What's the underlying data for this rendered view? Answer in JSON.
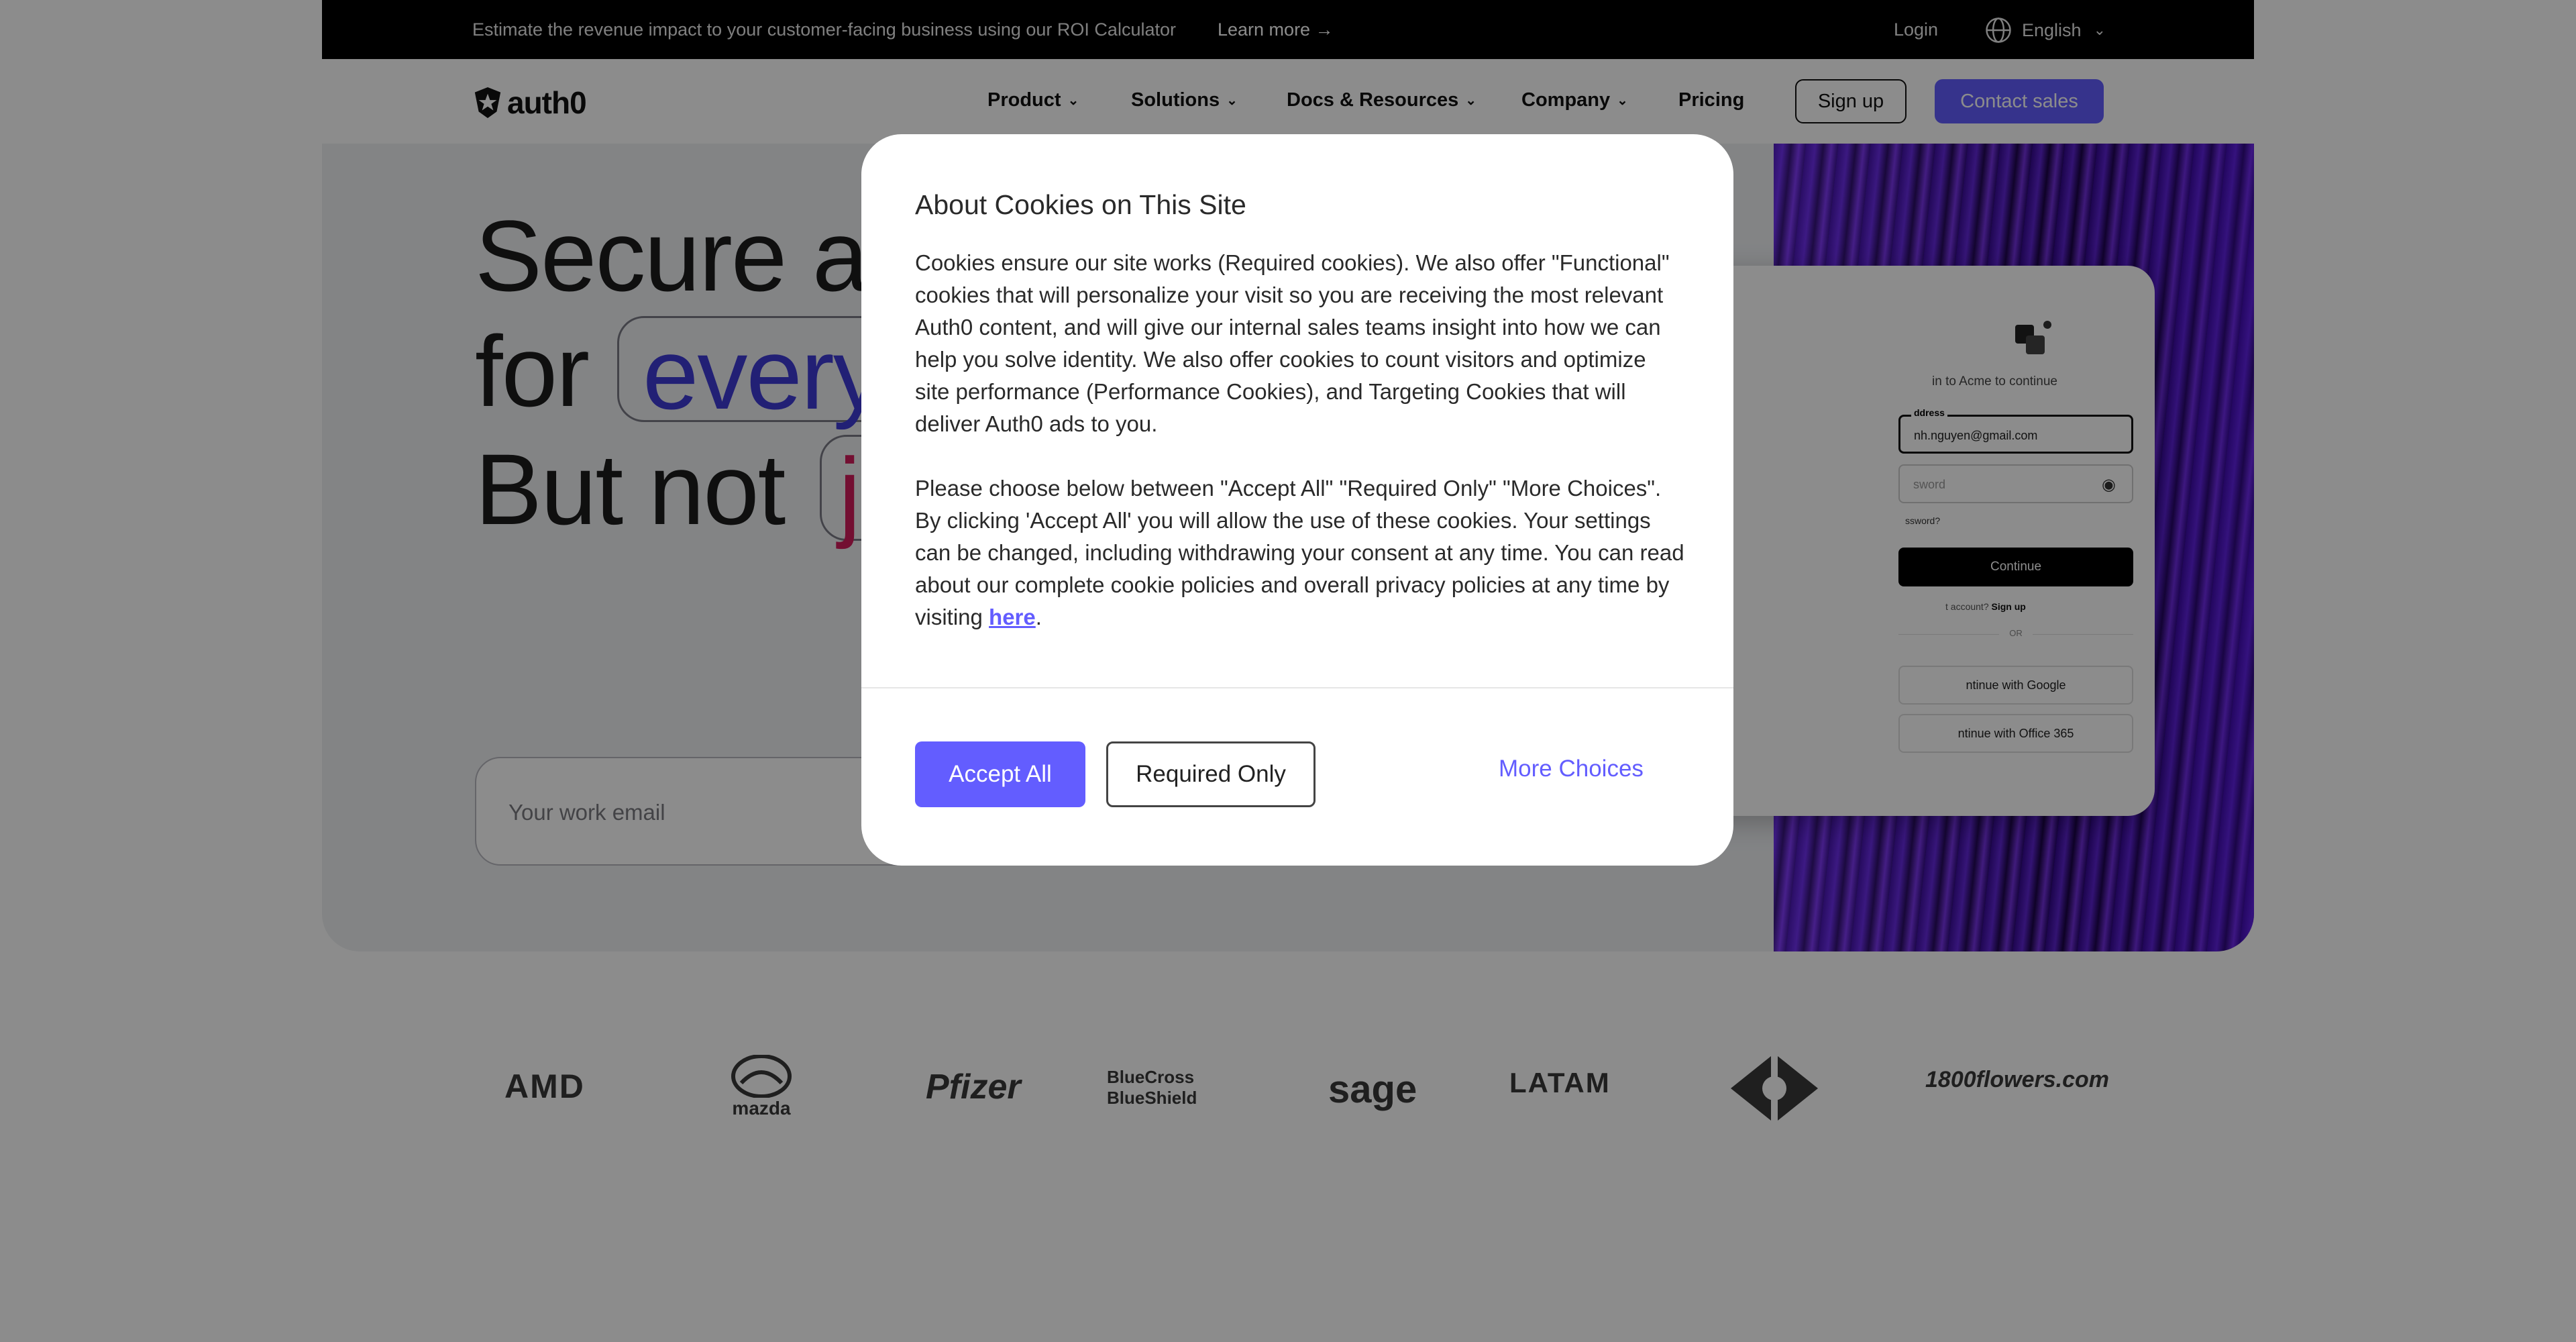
{
  "announcement": {
    "message": "Estimate the revenue impact to your customer-facing business using our ROI Calculator",
    "learn_more": "Learn more →",
    "login": "Login",
    "language": "English"
  },
  "nav": {
    "logo": "auth0",
    "items": [
      {
        "label": "Product",
        "has_dropdown": true
      },
      {
        "label": "Solutions",
        "has_dropdown": true
      },
      {
        "label": "Docs & Resources",
        "has_dropdown": true
      },
      {
        "label": "Company",
        "has_dropdown": true
      },
      {
        "label": "Pricing",
        "has_dropdown": false
      }
    ],
    "signup": "Sign up",
    "contact_sales": "Contact sales"
  },
  "hero": {
    "line1": "Secure a",
    "line2_prefix": "for",
    "line2_highlight": "every",
    "line3_prefix": "But not",
    "line3_highlight": "j",
    "email_placeholder": "Your work email"
  },
  "login_card": {
    "subtitle": "in to Acme to continue",
    "email_label": "ddress",
    "email_value": "nh.nguyen@gmail.com",
    "password_placeholder": "sword",
    "forgot": "ssword?",
    "continue": "Continue",
    "signup_prompt": "t account?",
    "signup_link": "Sign up",
    "or": "OR",
    "google": "ntinue with Google",
    "office": "ntinue with Office 365"
  },
  "logos": [
    "AMD",
    "mazda",
    "Pfizer",
    "BlueCross BlueShield",
    "sage",
    "LATAM",
    "Carrefour",
    "1800flowers.com"
  ],
  "cookie_modal": {
    "title": "About Cookies on This Site",
    "paragraph1": "Cookies ensure our site works (Required cookies). We also offer \"Functional\" cookies that will personalize your visit so you are receiving the most relevant Auth0 content, and will give our internal sales teams insight into how we can help you solve identity. We also offer cookies to count visitors and optimize site performance (Performance Cookies), and Targeting Cookies that will deliver Auth0 ads to you.",
    "paragraph2": "Please choose below between \"Accept All\" \"Required Only\" \"More Choices\". By clicking 'Accept All' you will allow the use of these cookies. Your settings can be changed, including withdrawing your consent at any time. You can read about our complete cookie policies and overall privacy policies at any time by visiting",
    "link_text": "here",
    "period": ".",
    "accept_all": "Accept All",
    "required_only": "Required Only",
    "more_choices": "More Choices"
  },
  "colors": {
    "accent": "#635dff",
    "highlight_blue": "#3f3bd6",
    "highlight_pink": "#d21c5b",
    "announcement_bg": "#000000"
  }
}
